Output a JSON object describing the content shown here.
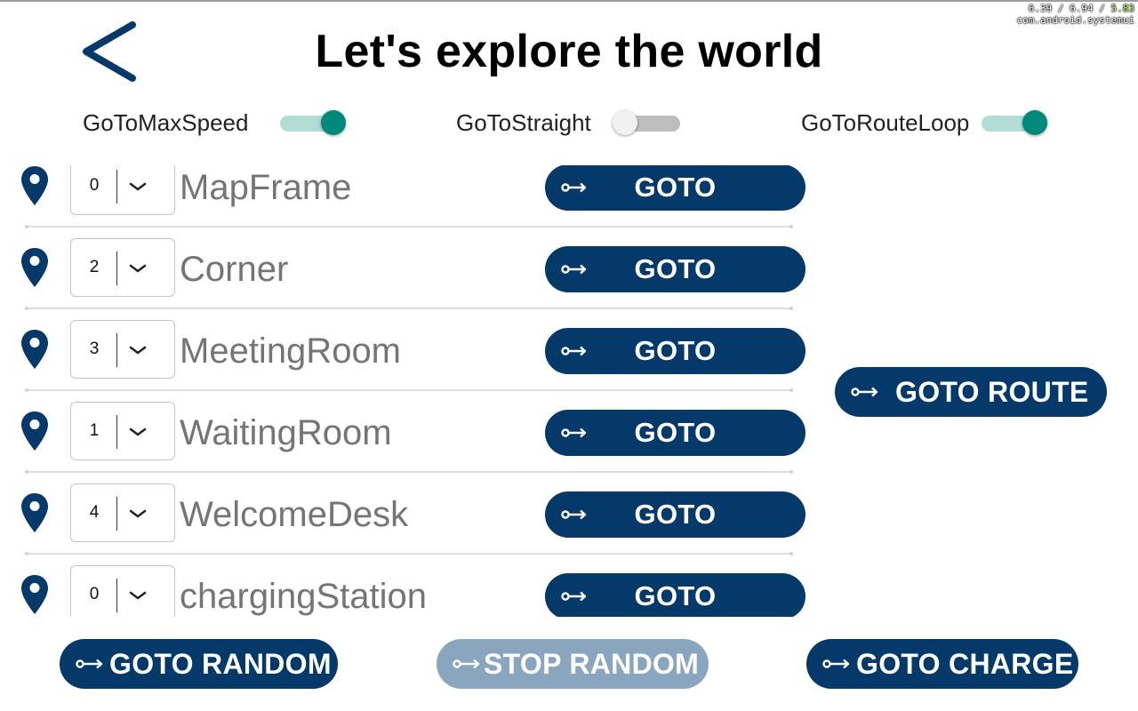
{
  "overlay": {
    "load": [
      "6.39",
      "6.94",
      "5.83"
    ],
    "sep": " / ",
    "process": "com.android.systemui"
  },
  "header": {
    "title": "Let's explore the world"
  },
  "toggles": [
    {
      "label": "GoToMaxSpeed",
      "on": true
    },
    {
      "label": "GoToStraight",
      "on": false
    },
    {
      "label": "GoToRouteLoop",
      "on": true
    }
  ],
  "locations": [
    {
      "order": "0",
      "name": "MapFrame",
      "button": "GOTO"
    },
    {
      "order": "2",
      "name": "Corner",
      "button": "GOTO"
    },
    {
      "order": "3",
      "name": "MeetingRoom",
      "button": "GOTO"
    },
    {
      "order": "1",
      "name": "WaitingRoom",
      "button": "GOTO"
    },
    {
      "order": "4",
      "name": "WelcomeDesk",
      "button": "GOTO"
    },
    {
      "order": "0",
      "name": "chargingStation",
      "button": "GOTO"
    }
  ],
  "actions": {
    "route": "GOTO ROUTE",
    "random": "GOTO RANDOM",
    "stop_random": "STOP RANDOM",
    "charge": "GOTO CHARGE"
  },
  "icons": {
    "back": "back-chevron-icon",
    "pin": "location-pin-icon",
    "arrow": "key-arrow-icon",
    "dropdown": "chevron-down-icon"
  },
  "colors": {
    "primary": "#04396a",
    "primary_disabled": "#8aa6bf",
    "switch_on": "#00897b",
    "switch_track_on": "#b3dcd7",
    "label_grey": "#757575"
  }
}
